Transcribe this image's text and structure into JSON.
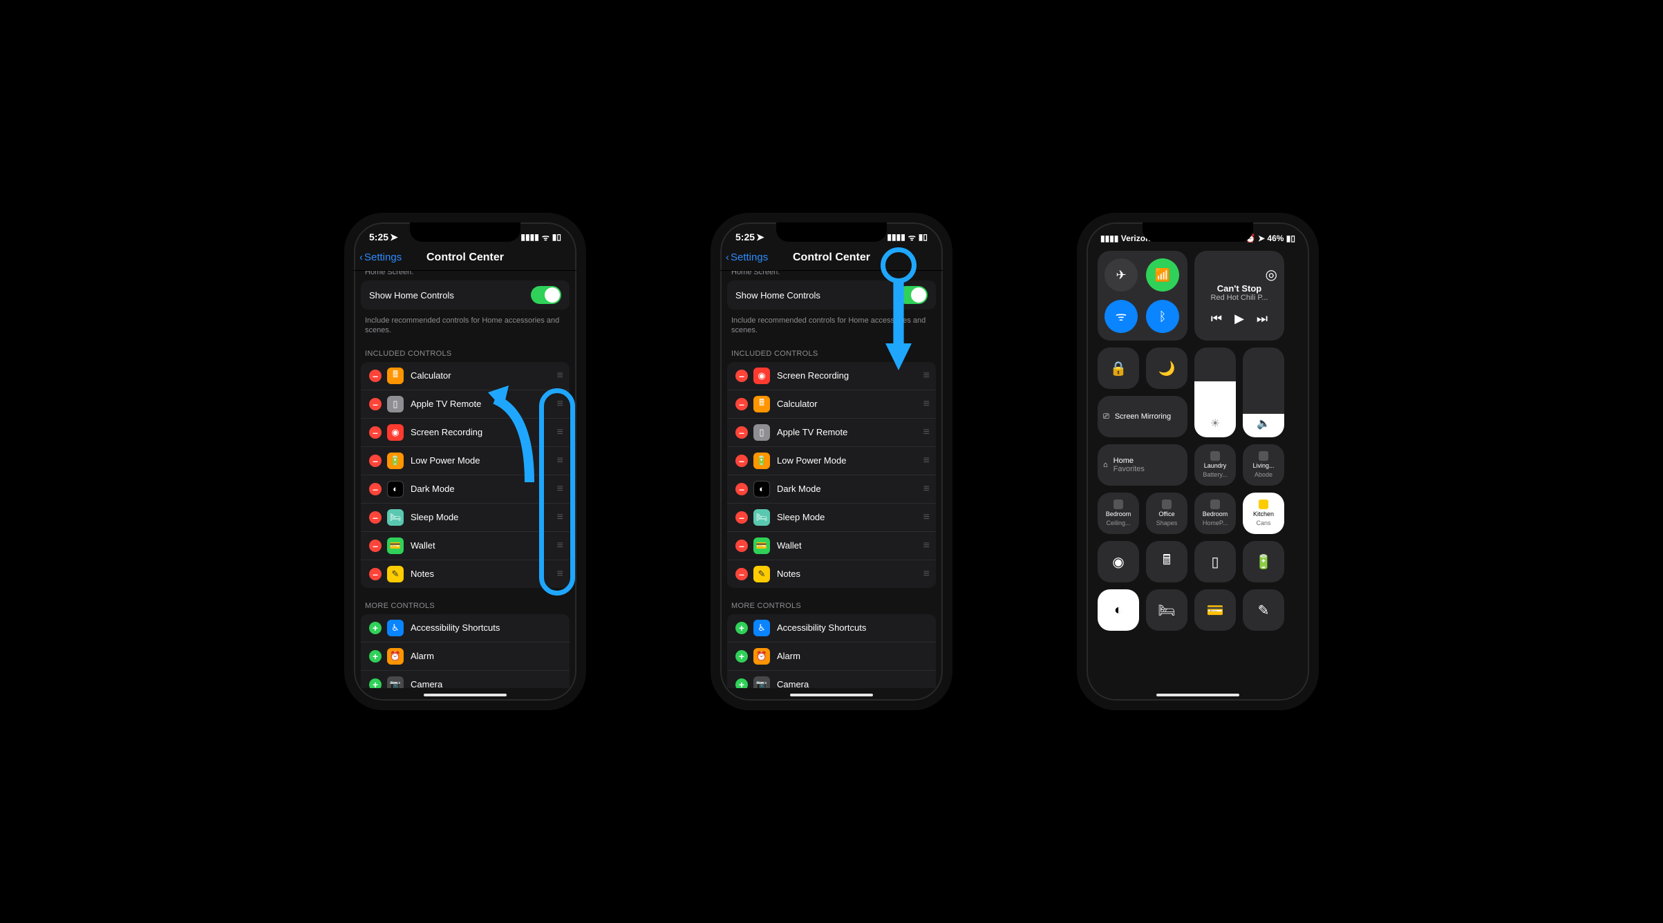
{
  "status_time": "5:25",
  "nav": {
    "back": "Settings",
    "title": "Control Center"
  },
  "truncated_top": "Home Screen.",
  "home_controls": {
    "label": "Show Home Controls",
    "caption": "Include recommended controls for Home accessories and scenes."
  },
  "section_included": "INCLUDED CONTROLS",
  "section_more": "MORE CONTROLS",
  "phone1_included": [
    {
      "label": "Calculator",
      "color": "ic-orange",
      "glyph": "🖩"
    },
    {
      "label": "Apple TV Remote",
      "color": "ic-gray",
      "glyph": "▯"
    },
    {
      "label": "Screen Recording",
      "color": "ic-red",
      "glyph": "◉"
    },
    {
      "label": "Low Power Mode",
      "color": "ic-orange",
      "glyph": "🔋"
    },
    {
      "label": "Dark Mode",
      "color": "ic-black",
      "glyph": "◐"
    },
    {
      "label": "Sleep Mode",
      "color": "ic-teal",
      "glyph": "🛏"
    },
    {
      "label": "Wallet",
      "color": "ic-green",
      "glyph": "💳"
    },
    {
      "label": "Notes",
      "color": "ic-yellow",
      "glyph": "✎"
    }
  ],
  "phone2_included": [
    {
      "label": "Screen Recording",
      "color": "ic-red",
      "glyph": "◉"
    },
    {
      "label": "Calculator",
      "color": "ic-orange",
      "glyph": "🖩"
    },
    {
      "label": "Apple TV Remote",
      "color": "ic-gray",
      "glyph": "▯"
    },
    {
      "label": "Low Power Mode",
      "color": "ic-orange",
      "glyph": "🔋"
    },
    {
      "label": "Dark Mode",
      "color": "ic-black",
      "glyph": "◐"
    },
    {
      "label": "Sleep Mode",
      "color": "ic-teal",
      "glyph": "🛏"
    },
    {
      "label": "Wallet",
      "color": "ic-green",
      "glyph": "💳"
    },
    {
      "label": "Notes",
      "color": "ic-yellow",
      "glyph": "✎"
    }
  ],
  "more": [
    {
      "label": "Accessibility Shortcuts",
      "color": "ic-blue",
      "glyph": "♿︎"
    },
    {
      "label": "Alarm",
      "color": "ic-orange",
      "glyph": "⏰"
    },
    {
      "label": "Camera",
      "color": "ic-darkgray",
      "glyph": "📷"
    }
  ],
  "cc": {
    "carrier": "Verizon",
    "battery": "46%",
    "media_title": "Can't Stop",
    "media_artist": "Red Hot Chili P...",
    "mirror": "Screen Mirroring",
    "home_tile": {
      "t": "Home",
      "s": "Favorites"
    },
    "tiles": [
      {
        "t": "Laundry",
        "s": "Battery..."
      },
      {
        "t": "Living...",
        "s": "Abode"
      },
      {
        "t": "Bedroom",
        "s": "Ceiling..."
      },
      {
        "t": "Office",
        "s": "Shapes"
      },
      {
        "t": "Bedroom",
        "s": "HomeP..."
      },
      {
        "t": "Kitchen",
        "s": "Cans"
      }
    ]
  }
}
